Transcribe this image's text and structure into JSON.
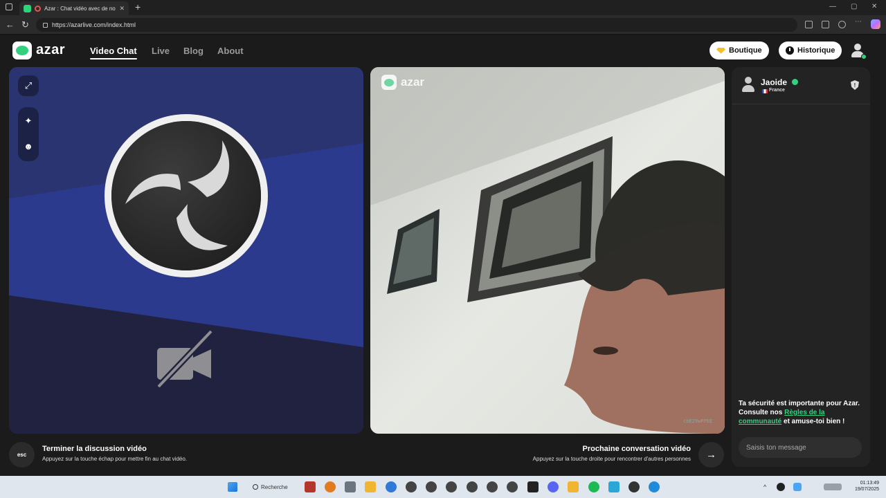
{
  "browser": {
    "tab_title": "Azar : Chat vidéo avec de nouv",
    "tab_close": "✕",
    "new_tab": "+",
    "url": "https://azarlive.com/index.html",
    "back_icon": "←",
    "reload_icon": "↻",
    "window_controls": [
      "—",
      "▢",
      "✕"
    ]
  },
  "header": {
    "logo_text": "azar",
    "nav": [
      {
        "label": "Video Chat",
        "active": true
      },
      {
        "label": "Live",
        "active": false
      },
      {
        "label": "Blog",
        "active": false
      },
      {
        "label": "About",
        "active": false
      }
    ],
    "boutique_label": "Boutique",
    "historique_label": "Historique"
  },
  "left_panel": {
    "expand_icon": "⤢",
    "sparkle_icon": "✦",
    "face_icon": "☻"
  },
  "video": {
    "watermark": "azar",
    "session_id": "cbE29wPPEE"
  },
  "chat": {
    "peer_name": "Jaoide",
    "peer_country": "France",
    "report_icon": "!",
    "safety_prefix": "Ta sécurité est importante pour Azar. Consulte nos ",
    "safety_link": "Règles de la communauté",
    "safety_suffix": " et amuse-toi bien !",
    "input_placeholder": "Saisis ton message"
  },
  "controls": {
    "esc_label": "esc",
    "end_title": "Terminer la discussion vidéo",
    "end_subtitle": "Appuyez sur la touche échap pour mettre fin au chat vidéo.",
    "next_title": "Prochaine conversation vidéo",
    "next_subtitle": "Appuyez sur la touche droite pour rencontrer d'autres personnes",
    "next_icon": "→"
  },
  "taskbar": {
    "search_label": "Recherche",
    "time": "01:13:49",
    "date": "19/07/2025",
    "tray_chevron": "^"
  },
  "colors": {
    "accent": "#35d07f",
    "left_panel_top": "#283473",
    "left_panel_bottom": "#1e2148"
  }
}
